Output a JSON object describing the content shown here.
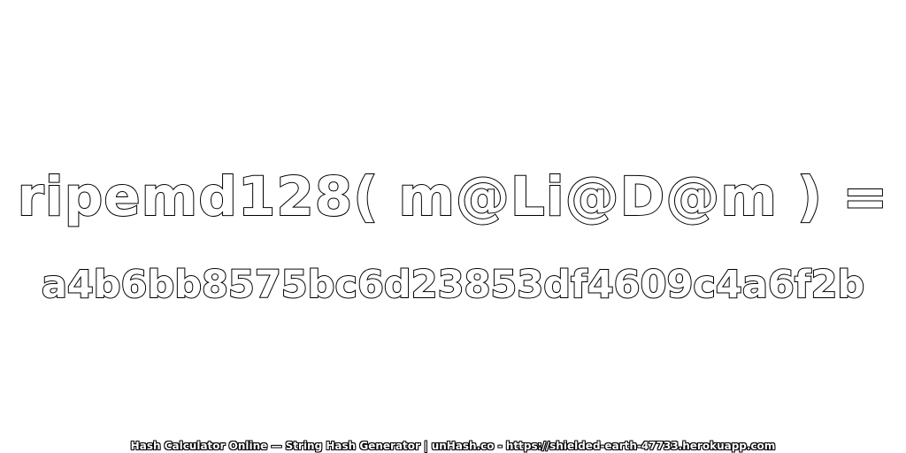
{
  "expression": "ripemd128( m@Li@D@m ) =",
  "hash_value": "a4b6bb8575bc6d23853df4609c4a6f2b",
  "footer": "Hash Calculator Online — String Hash Generator | unHash.co - https://shielded-earth-47733.herokuapp.com",
  "colors": {
    "background": "#ffffff",
    "text_fill": "#ffffff",
    "text_outline": "#000000"
  }
}
